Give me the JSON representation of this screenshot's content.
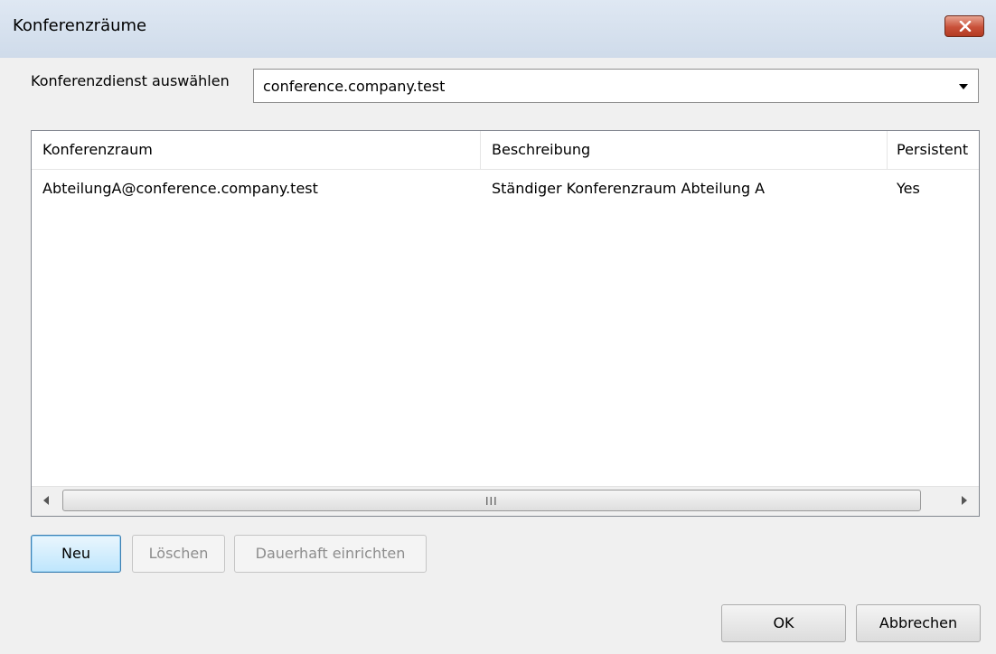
{
  "window": {
    "title": "Konferenzräume"
  },
  "service": {
    "label": "Konferenzdienst auswählen",
    "selected": "conference.company.test"
  },
  "table": {
    "columns": [
      "Konferenzraum",
      "Beschreibung",
      "Persistent"
    ],
    "rows": [
      [
        "AbteilungA@conference.company.test",
        "Ständiger Konferenzraum Abteilung A",
        "Yes"
      ]
    ]
  },
  "scrollbar": {
    "grip": "III"
  },
  "actions": {
    "new": "Neu",
    "delete": "Löschen",
    "persist": "Dauerhaft einrichten"
  },
  "footer": {
    "ok": "OK",
    "cancel": "Abbrechen"
  },
  "icons": {
    "close": "close-icon",
    "dropdown": "chevron-down-icon",
    "scroll_left": "arrow-left-icon",
    "scroll_right": "arrow-right-icon"
  }
}
